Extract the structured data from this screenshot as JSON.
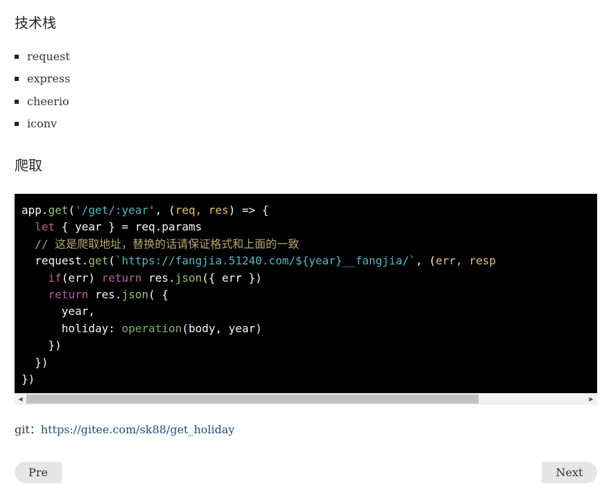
{
  "headings": {
    "stack": "技术栈",
    "crawl": "爬取"
  },
  "stack_items": [
    "request",
    "express",
    "cheerio",
    "iconv"
  ],
  "code": {
    "lines": [
      [
        [
          "",
          "app."
        ],
        [
          "fn",
          "get"
        ],
        [
          "",
          "("
        ],
        [
          "str",
          "'/get/:year'"
        ],
        [
          "",
          ", ("
        ],
        [
          "param",
          "req, res"
        ],
        [
          "",
          ") => {"
        ]
      ],
      [
        [
          "",
          "  "
        ],
        [
          "kwm",
          "let"
        ],
        [
          "",
          " { year } = req.params"
        ]
      ],
      [
        [
          "",
          "  "
        ],
        [
          "cmt",
          "// 这是爬取地址，替换的话请保证格式和上面的一致"
        ]
      ],
      [
        [
          "",
          "  request."
        ],
        [
          "fn",
          "get"
        ],
        [
          "",
          "("
        ],
        [
          "str",
          "`https://fangjia.51240.com/${year}__fangjia/`"
        ],
        [
          "",
          ", ("
        ],
        [
          "param",
          "err, resp"
        ]
      ],
      [
        [
          "",
          "    "
        ],
        [
          "kwm",
          "if"
        ],
        [
          "",
          "(err) "
        ],
        [
          "kwm",
          "return"
        ],
        [
          "",
          " res."
        ],
        [
          "fn",
          "json"
        ],
        [
          "",
          "({ err })"
        ]
      ],
      [
        [
          "",
          "    "
        ],
        [
          "kwm",
          "return"
        ],
        [
          "",
          " res."
        ],
        [
          "fn",
          "json"
        ],
        [
          "",
          "( {"
        ]
      ],
      [
        [
          "",
          "      year,"
        ]
      ],
      [
        [
          "",
          "      holiday: "
        ],
        [
          "fn2",
          "operation"
        ],
        [
          "",
          "(body, year)"
        ]
      ],
      [
        [
          "",
          "    })"
        ]
      ],
      [
        [
          "",
          "  })"
        ]
      ],
      [
        [
          "",
          "})"
        ]
      ]
    ]
  },
  "git": {
    "label": "git：",
    "url": "https://gitee.com/sk88/get_holiday"
  },
  "nav": {
    "pre_label": "Pre",
    "next_label": "Next"
  },
  "icons": {
    "scroll_left": "triangle-left-icon",
    "scroll_right": "triangle-right-icon"
  }
}
